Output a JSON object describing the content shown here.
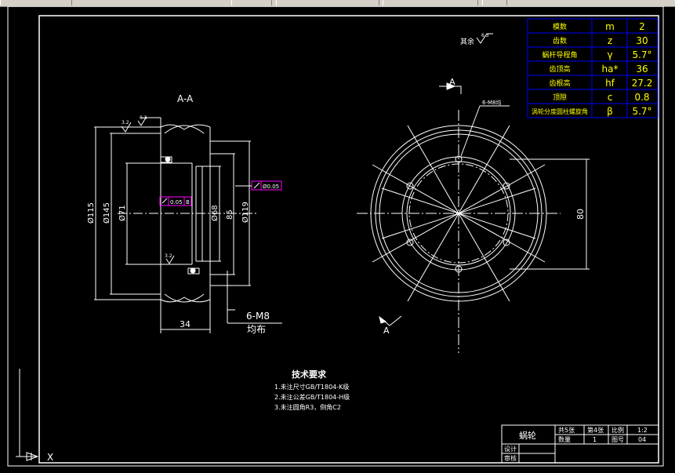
{
  "drawing": {
    "section_label": "A-A",
    "view_label": "A",
    "view_label_bottom": "A",
    "roughness_note": "其余",
    "roughness_value": "6.3",
    "thread_note_top": "6-M8均",
    "thread_callout": "6-M8",
    "thread_callout_sub": "均布",
    "dims": {
      "d115": "Ø115",
      "d145": "Ø145",
      "d71": "Ø71",
      "d68": "Ø68",
      "d85": "85",
      "d119": "Ø119",
      "w34": "34",
      "v80": "80"
    },
    "tolerances": {
      "runout1": "0.05",
      "runout1_datum": "B",
      "runout2": "Ø0.05",
      "rough1": "3.2",
      "rough2": "6.3",
      "rough3": "3.2"
    }
  },
  "param_table": {
    "rows": [
      {
        "name": "模数",
        "sym": "m",
        "val": "2"
      },
      {
        "name": "齿数",
        "sym": "z",
        "val": "30"
      },
      {
        "name": "蜗杆导程角",
        "sym": "γ",
        "val": "5.7°"
      },
      {
        "name": "齿顶高",
        "sym": "ha*",
        "val": "36"
      },
      {
        "name": "齿根高",
        "sym": "hf",
        "val": "27.2"
      },
      {
        "name": "顶隙",
        "sym": "c",
        "val": "0.8"
      },
      {
        "name": "涡轮分度圆柱螺旋角",
        "sym": "β",
        "val": "5.7°"
      }
    ]
  },
  "tech_req": {
    "title": "技术要求",
    "lines": [
      "1.未注尺寸GB/T1804-K级",
      "2.未注公差GB/T1804-H级",
      "3.未注圆角R3，倒角C2"
    ]
  },
  "title_block": {
    "part_name": "蜗轮",
    "cells": [
      "共5张",
      "第4张",
      "比例",
      "1:2",
      "数量",
      "1",
      "图号",
      "04",
      "设计",
      "审核"
    ]
  },
  "ucs": {
    "x": "X"
  }
}
